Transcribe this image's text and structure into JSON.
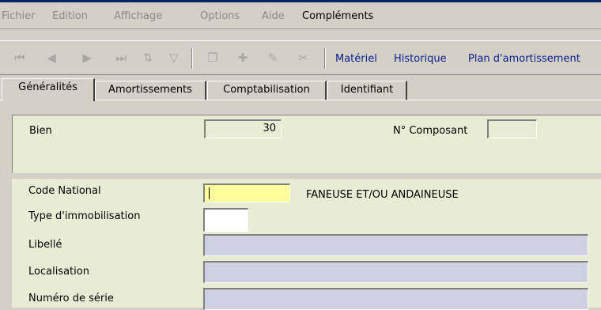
{
  "menu": {
    "items": [
      "Fichier",
      "Edition",
      "Affichage",
      "Options",
      "Aide",
      "Compléments"
    ]
  },
  "toolbar": {
    "icons": [
      "first-icon",
      "prev-icon",
      "next-icon",
      "last-icon",
      "sort-icon",
      "filter-icon",
      "copy-icon",
      "add-icon",
      "edit-icon",
      "delete-icon"
    ],
    "links": [
      "Matériel",
      "Historique",
      "Plan d'amortissement"
    ]
  },
  "tabs": [
    "Généralités",
    "Amortissements",
    "Comptabilisation",
    "Identifiant"
  ],
  "form": {
    "bien_label": "Bien",
    "bien_value": "30",
    "composant_label": "N° Composant",
    "composant_value": "",
    "code_national_label": "Code National",
    "code_national_value": "",
    "code_national_desc": "FANEUSE ET/OU ANDAINEUSE",
    "type_label": "Type d'immobilisation",
    "type_value": "",
    "libelle_label": "Libellé",
    "libelle_value": "",
    "localisation_label": "Localisation",
    "localisation_value": "",
    "numero_label": "Numéro de série",
    "numero_value": ""
  },
  "colors": {
    "panel_green": "#e9ecd4",
    "active_field": "#ffff99",
    "readonly_field": "#cfd0e2",
    "link_blue": "#0a1f8a"
  }
}
